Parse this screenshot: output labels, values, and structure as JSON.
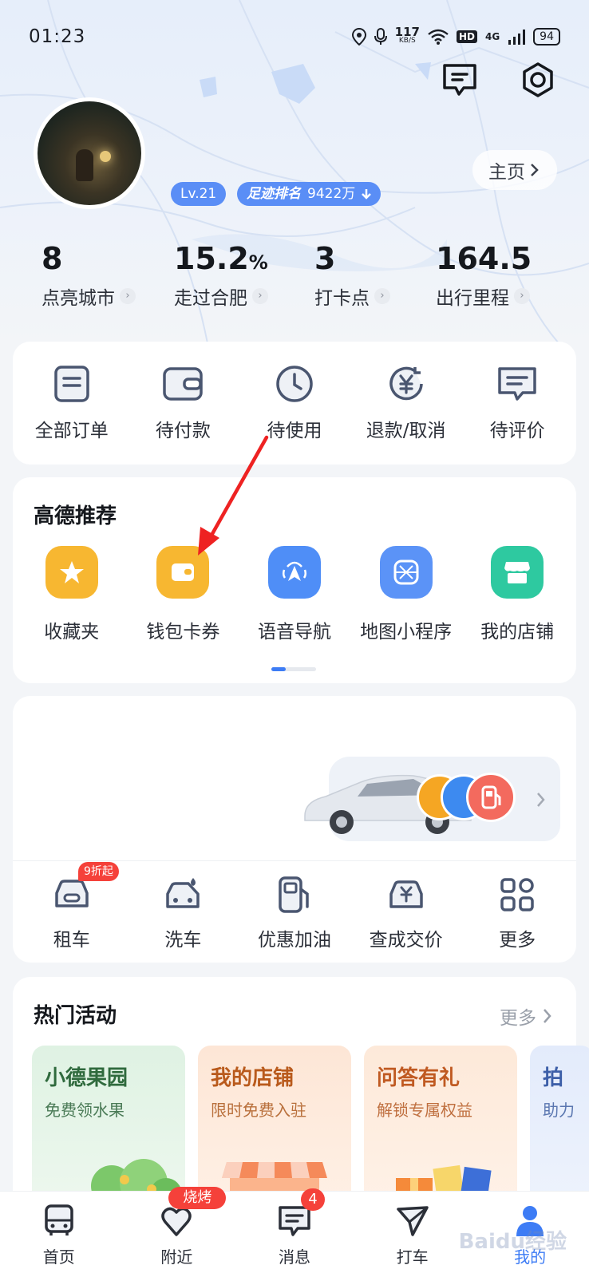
{
  "status_bar": {
    "time": "01:23",
    "speed_value": "117",
    "speed_unit": "KB/S",
    "hd": "HD",
    "network": "4G",
    "battery": "94"
  },
  "profile": {
    "level": "Lv.21",
    "rank_label": "足迹排名",
    "rank_value": "9422万",
    "homepage_label": "主页"
  },
  "stats": [
    {
      "value": "8",
      "suffix": "",
      "label": "点亮城市"
    },
    {
      "value": "15.2",
      "suffix": "%",
      "label": "走过合肥"
    },
    {
      "value": "3",
      "suffix": "",
      "label": "打卡点"
    },
    {
      "value": "164.5",
      "suffix": "",
      "label": "出行里程"
    }
  ],
  "orders": [
    "全部订单",
    "待付款",
    "待使用",
    "退款/取消",
    "待评价"
  ],
  "recommend": {
    "title": "高德推荐",
    "items": [
      {
        "label": "收藏夹",
        "color": "#f7b731",
        "icon": "star-icon"
      },
      {
        "label": "钱包卡券",
        "color": "#f7b731",
        "icon": "wallet-icon"
      },
      {
        "label": "语音导航",
        "color": "#4f8ef7",
        "icon": "voice-nav-icon"
      },
      {
        "label": "地图小程序",
        "color": "#5b93f7",
        "icon": "mini-program-icon"
      },
      {
        "label": "我的店铺",
        "color": "#2ec9a0",
        "icon": "shop-icon"
      }
    ]
  },
  "car_services": {
    "items": [
      "租车",
      "洗车",
      "优惠加油",
      "查成交价",
      "更多"
    ],
    "rent_badge": "9折起"
  },
  "hot_activities": {
    "title": "热门活动",
    "more": "更多",
    "cards": [
      {
        "title": "小德果园",
        "subtitle": "免费领水果"
      },
      {
        "title": "我的店铺",
        "subtitle": "限时免费入驻"
      },
      {
        "title": "问答有礼",
        "subtitle": "解锁专属权益"
      },
      {
        "title": "拍",
        "subtitle": "助力"
      }
    ]
  },
  "bottom_nav": [
    {
      "label": "首页"
    },
    {
      "label": "附近",
      "badge": "烧烤"
    },
    {
      "label": "消息",
      "badge": "4"
    },
    {
      "label": "打车"
    },
    {
      "label": "我的"
    }
  ],
  "watermark": "Baidu经验"
}
